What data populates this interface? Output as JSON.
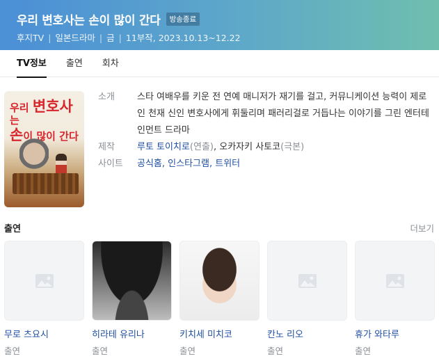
{
  "header": {
    "title": "우리 변호사는 손이 많이 간다",
    "badge": "방송종료",
    "network": "후지TV",
    "genre": "일본드라마",
    "day": "금",
    "episodes_dates": "11부작, 2023.10.13~12.22",
    "colors": {
      "gradient_start": "#4b8fd6",
      "gradient_end": "#6fbfae"
    }
  },
  "tabs": [
    {
      "label": "TV정보",
      "active": true
    },
    {
      "label": "출연",
      "active": false
    },
    {
      "label": "회차",
      "active": false
    }
  ],
  "poster": {
    "line1_a": "우리 ",
    "line1_b": "변호사",
    "line1_c": "는",
    "line2_a": "손",
    "line2_b": "이 많이 간다"
  },
  "info": {
    "intro_label": "소개",
    "intro_text": "스타 여배우를 키운 전 연예 매니저가 재기를 걸고, 커뮤니케이션 능력이 제로인 천재 신인 변호사에게 휘둘리며 패러리걸로 거듭나는 이야기를 그린 엔터테인먼트 드라마",
    "production_label": "제작",
    "production_person1": "루토 토이치로",
    "production_role1": "(연출)",
    "production_sep": ", ",
    "production_person2": "오카자키 사토코",
    "production_role2": "(극본)",
    "site_label": "사이트",
    "site_links": [
      "공식홈",
      "인스타그램",
      "트위터"
    ],
    "site_sep": ", "
  },
  "cast_section": {
    "title": "출연",
    "more": "더보기",
    "items": [
      {
        "name": "무로 츠요시",
        "role": "출연",
        "photo": "placeholder"
      },
      {
        "name": "히라테 유리나",
        "role": "출연",
        "photo": "dark-hat-portrait"
      },
      {
        "name": "키치세 미치코",
        "role": "출연",
        "photo": "light-portrait"
      },
      {
        "name": "칸노 리오",
        "role": "출연",
        "photo": "placeholder"
      },
      {
        "name": "휴가 와타루",
        "role": "출연",
        "photo": "placeholder"
      }
    ]
  }
}
